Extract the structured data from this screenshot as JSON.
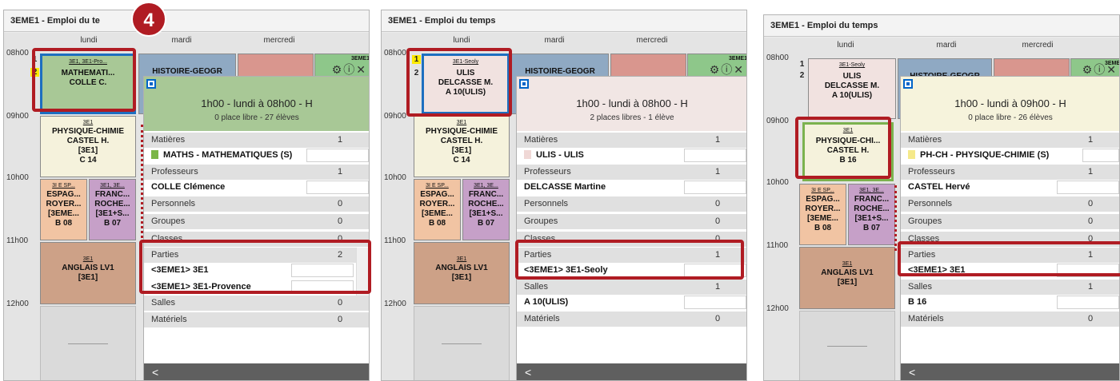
{
  "badge": "4",
  "days": [
    "lundi",
    "mardi",
    "mercredi"
  ],
  "panels": [
    {
      "title": "3EME1 - Emploi du te",
      "hours": [
        "08h00",
        "09h00",
        "10h00",
        "11h00",
        "12h00"
      ],
      "slot_numbers": [
        "1",
        "2"
      ],
      "cells": {
        "first": {
          "small": "3E1, 3E1-Pro...",
          "text": "MATHEMATI...\nCOLLE C."
        },
        "hist": "HISTOIRE-GEOGR",
        "phys": {
          "small": "3E1",
          "text": "PHYSIQUE-CHIMIE\nCASTEL H.\n[3E1]\nC 14"
        },
        "esp": {
          "small": "3I E SP...",
          "text": "ESPAG...\nROYER...\n[3EME...\nB 08"
        },
        "fra": {
          "small": "3E1, 3E...",
          "text": "FRANC...\nROCHE...\n[3E1+S...\nB 07"
        },
        "ang": {
          "small": "3E1",
          "text": "ANGLAIS LV1\n[3E1]"
        },
        "peek": "3EME1"
      },
      "popup": {
        "time": "1h00 - lundi à 08h00 - H",
        "places": "0 place libre - 27 élèves",
        "matieres": {
          "label": "Matières",
          "count": "1",
          "value": "MATHS - MATHEMATIQUES (S)",
          "color": "#7ab648"
        },
        "professeurs": {
          "label": "Professeurs",
          "count": "1",
          "value": "COLLE Clémence"
        },
        "personnels": {
          "label": "Personnels",
          "count": "0"
        },
        "groupes": {
          "label": "Groupes",
          "count": "0"
        },
        "classes": {
          "label": "Classes",
          "count": "0"
        },
        "parties": {
          "label": "Parties",
          "count": "2",
          "values": [
            "<3EME1> 3E1",
            "<3EME1> 3E1-Provence"
          ]
        },
        "salles": {
          "label": "Salles",
          "count": "0"
        },
        "materiels": {
          "label": "Matériels",
          "count": "0"
        },
        "header_color": "#a8c896"
      }
    },
    {
      "title": "3EME1 - Emploi du temps",
      "hours": [
        "08h00",
        "09h00",
        "10h00",
        "11h00",
        "12h00"
      ],
      "slot_numbers": [
        "1",
        "2"
      ],
      "cells": {
        "first": {
          "small": "3E1-Seoly",
          "text": "ULIS\nDELCASSE M.\nA 10(ULIS)"
        },
        "hist": "HISTOIRE-GEOGR",
        "phys": {
          "small": "3E1",
          "text": "PHYSIQUE-CHIMIE\nCASTEL H.\n[3E1]\nC 14"
        },
        "esp": {
          "small": "3I E SP...",
          "text": "ESPAG...\nROYER...\n[3EME...\nB 08"
        },
        "fra": {
          "small": "3E1, 3E...",
          "text": "FRANC...\nROCHE...\n[3E1+S...\nB 07"
        },
        "ang": {
          "small": "3E1",
          "text": "ANGLAIS LV1\n[3E1]"
        },
        "peek": "3EME1"
      },
      "popup": {
        "time": "1h00 - lundi à 08h00 - H",
        "places": "2 places libres - 1 élève",
        "matieres": {
          "label": "Matières",
          "count": "1",
          "value": "ULIS - ULIS",
          "color": "#f0d8d6"
        },
        "professeurs": {
          "label": "Professeurs",
          "count": "1",
          "value": "DELCASSE Martine"
        },
        "personnels": {
          "label": "Personnels",
          "count": "0"
        },
        "groupes": {
          "label": "Groupes",
          "count": "0"
        },
        "classes": {
          "label": "Classes",
          "count": "0"
        },
        "parties": {
          "label": "Parties",
          "count": "1",
          "values": [
            "<3EME1> 3E1-Seoly"
          ]
        },
        "salles": {
          "label": "Salles",
          "count": "1",
          "value": "A 10(ULIS)"
        },
        "materiels": {
          "label": "Matériels",
          "count": "0"
        },
        "header_color": "#f1e6e4"
      }
    },
    {
      "title": "3EME1 - Emploi du temps",
      "hours": [
        "08h00",
        "09h00",
        "10h00",
        "11h00",
        "12h00"
      ],
      "slot_numbers": [
        "1",
        "2"
      ],
      "cells": {
        "first": {
          "small": "3E1-Seoly",
          "text": "ULIS\nDELCASSE M.\nA 10(ULIS)"
        },
        "hist": "HISTOIRE-GEOGR",
        "phys": {
          "small": "3E1",
          "text": "PHYSIQUE-CHI...\nCASTEL H.\nB 16"
        },
        "esp": {
          "small": "3I E SP...",
          "text": "ESPAG...\nROYER...\n[3EME...\nB 08"
        },
        "fra": {
          "small": "3E1, 3E...",
          "text": "FRANC...\nROCHE...\n[3E1+S...\nB 07"
        },
        "ang": {
          "small": "3E1",
          "text": "ANGLAIS LV1\n[3E1]"
        },
        "peek": "3EME"
      },
      "popup": {
        "time": "1h00 - lundi à 09h00 - H",
        "places": "0 place libre - 26 élèves",
        "matieres": {
          "label": "Matières",
          "count": "1",
          "value": "PH-CH - PHYSIQUE-CHIMIE (S)",
          "color": "#f5e98a"
        },
        "professeurs": {
          "label": "Professeurs",
          "count": "1",
          "value": "CASTEL Hervé"
        },
        "personnels": {
          "label": "Personnels",
          "count": "0"
        },
        "groupes": {
          "label": "Groupes",
          "count": "0"
        },
        "classes": {
          "label": "Classes",
          "count": "0"
        },
        "parties": {
          "label": "Parties",
          "count": "1",
          "values": [
            "<3EME1> 3E1"
          ]
        },
        "salles": {
          "label": "Salles",
          "count": "1",
          "value": "B 16"
        },
        "materiels": {
          "label": "Matériels",
          "count": "0"
        },
        "header_color": "#f6f3dc"
      }
    }
  ],
  "icons": {
    "gear": "gear-icon",
    "info": "info-icon",
    "close": "close-icon",
    "share": "share-icon"
  }
}
